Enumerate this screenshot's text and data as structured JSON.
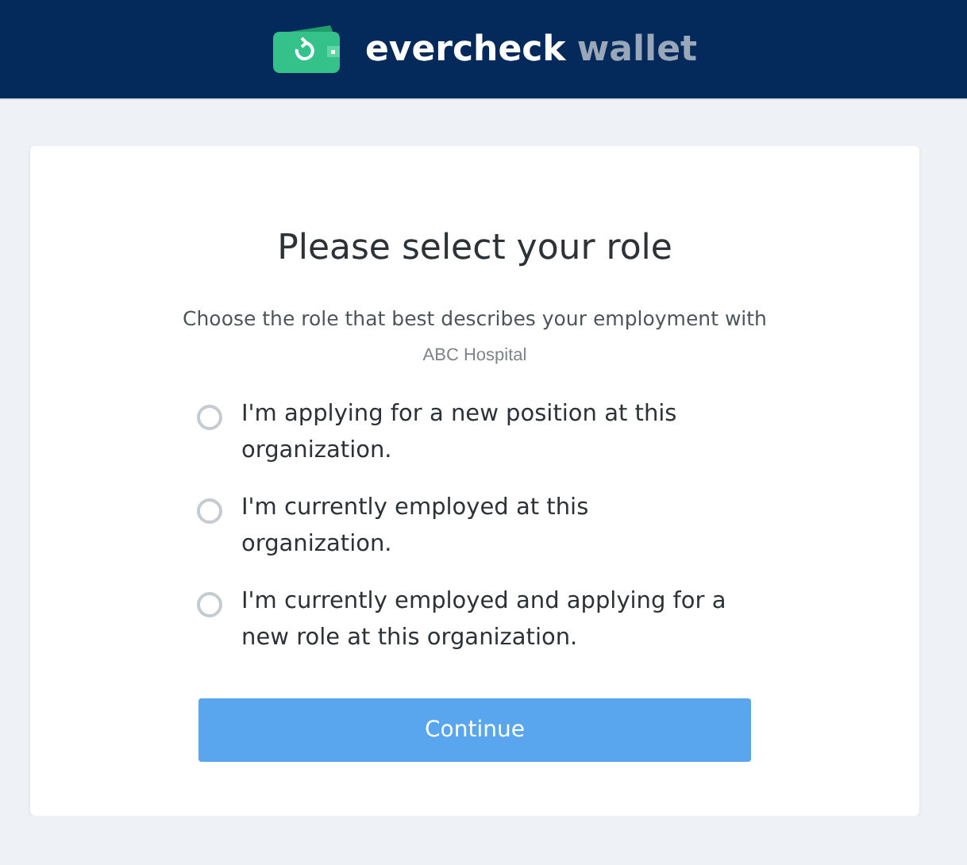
{
  "header": {
    "brand": "evercheck",
    "product": "wallet"
  },
  "card": {
    "title": "Please select your role",
    "subtitle": "Choose the role that best describes your employment with",
    "organization": "ABC Hospital",
    "options": [
      {
        "label": "I'm applying for a new position at this organization.",
        "selected": false
      },
      {
        "label": "I'm currently employed at this organization.",
        "selected": false
      },
      {
        "label": "I'm currently employed and applying for a new role at this organization.",
        "selected": false
      }
    ],
    "button": "Continue"
  }
}
